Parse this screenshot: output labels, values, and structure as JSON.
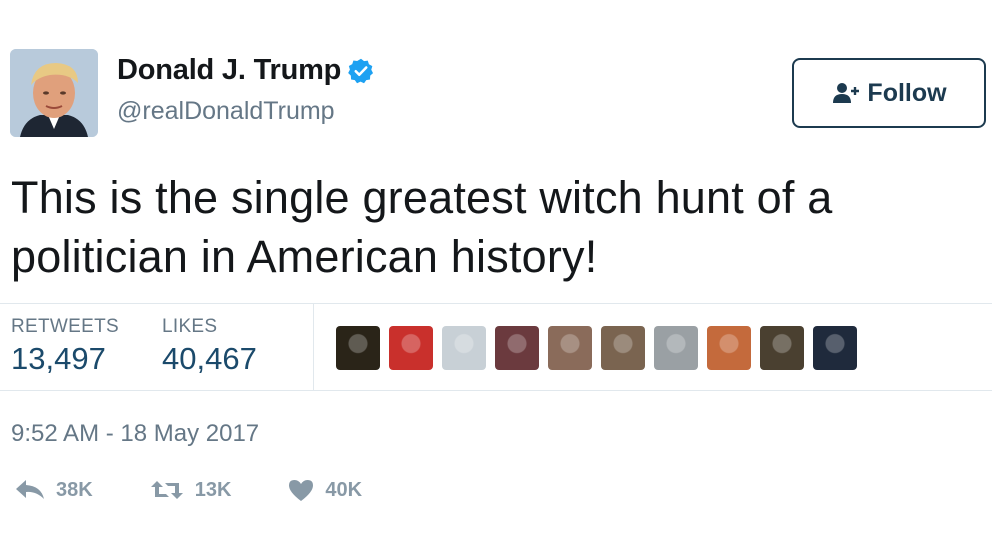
{
  "author": {
    "name": "Donald J. Trump",
    "handle": "@realDonaldTrump",
    "verified_icon": "verified-badge-icon"
  },
  "follow_button": {
    "label": "Follow",
    "icon": "add-user-icon"
  },
  "tweet": {
    "text_line1": "This is the single greatest witch hunt of a",
    "text_line2": "politician in American history!"
  },
  "stats": {
    "retweets_label": "RETWEETS",
    "retweets_value": "13,497",
    "likes_label": "LIKES",
    "likes_value": "40,467"
  },
  "likers": [
    {
      "color": "#2a2418"
    },
    {
      "color": "#c9302c"
    },
    {
      "color": "#c8d0d6"
    },
    {
      "color": "#6b3a3e"
    },
    {
      "color": "#8a6b5a"
    },
    {
      "color": "#7a6450"
    },
    {
      "color": "#9aa0a4"
    },
    {
      "color": "#c46a3c"
    },
    {
      "color": "#4a4030"
    },
    {
      "color": "#1f2a3c"
    }
  ],
  "timestamp": "9:52 AM - 18 May 2017",
  "actions": {
    "reply_count": "38K",
    "retweet_count": "13K",
    "like_count": "40K"
  },
  "colors": {
    "text": "#14171a",
    "muted": "#657786",
    "stat_value": "#1b4a6b",
    "verified": "#1da1f2",
    "action_icon": "#8899a6",
    "divider": "#e1e8ed"
  }
}
